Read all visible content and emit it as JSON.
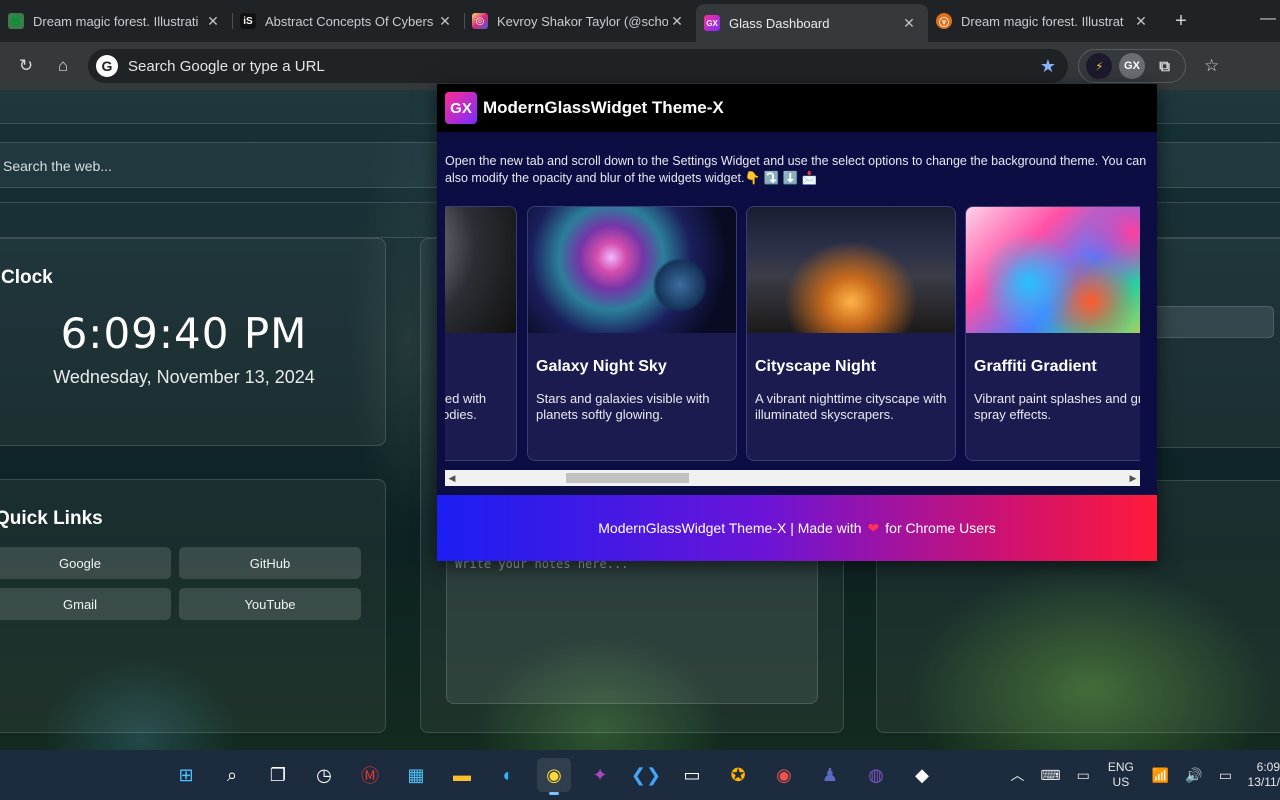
{
  "browser": {
    "tabs": [
      {
        "title": "Dream magic forest. Illustrati",
        "favicon": "forest-favicon"
      },
      {
        "title": "Abstract Concepts Of Cybers",
        "favicon": "is-favicon"
      },
      {
        "title": "Kevroy Shakor Taylor (@scho",
        "favicon": "instagram-favicon"
      },
      {
        "title": "Glass Dashboard",
        "favicon": "gx-favicon"
      },
      {
        "title": "Dream magic forest. Illustrat",
        "favicon": "forest-favicon"
      }
    ],
    "active_tab_index": 3,
    "omnibox_placeholder": "Search Google or type a URL"
  },
  "dashboard": {
    "search_placeholder": "Search the web...",
    "clock": {
      "header": "Clock",
      "time": "6:09:40 PM",
      "date": "Wednesday, November 13, 2024"
    },
    "quick_links": {
      "header": "Quick Links",
      "links": [
        "Google",
        "GitHub",
        "Gmail",
        "YouTube"
      ]
    },
    "notes_placeholder": "Write your notes here..."
  },
  "popup": {
    "logo_text": "GX",
    "title": "ModernGlassWidget Theme-X",
    "description": "Open the new tab and scroll down to the Settings Widget and use the select options to change the background theme. You can also modify the opacity and blur of the widgets widget.👇 ⤵️ ⬇️ 📩",
    "themes": [
      {
        "title": "",
        "description": "led with odies."
      },
      {
        "title": "Galaxy Night Sky",
        "description": "Stars and galaxies visible with planets softly glowing."
      },
      {
        "title": "Cityscape Night",
        "description": "A vibrant nighttime cityscape with illuminated skyscrapers."
      },
      {
        "title": "Graffiti Gradient",
        "description": "Vibrant paint splashes and graffiti spray effects."
      }
    ],
    "footer_prefix": "ModernGlassWidget Theme-X | Made with",
    "footer_heart": "❤",
    "footer_suffix": "for Chrome Users"
  },
  "taskbar": {
    "language": "ENG",
    "region": "US",
    "time": "6:09",
    "date": "13/11/"
  },
  "colors": {
    "popup_bg": "#0c0d42",
    "footer_gradient_start": "#1b1ef2",
    "footer_gradient_end": "#ff1a3a",
    "accent_star": "#8ab4f8"
  }
}
